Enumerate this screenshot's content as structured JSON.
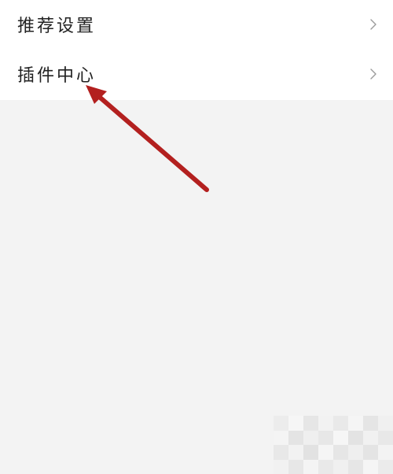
{
  "menu": {
    "items": [
      {
        "label": "推荐设置",
        "icon": "chevron-right-icon"
      },
      {
        "label": "插件中心",
        "icon": "chevron-right-icon"
      }
    ]
  },
  "annotation": {
    "arrow_color": "#b3201f",
    "points_to": "插件中心"
  },
  "colors": {
    "page_background": "#f3f3f3",
    "menu_background": "#ffffff",
    "text": "#222222",
    "chevron": "#9a9a9a"
  }
}
